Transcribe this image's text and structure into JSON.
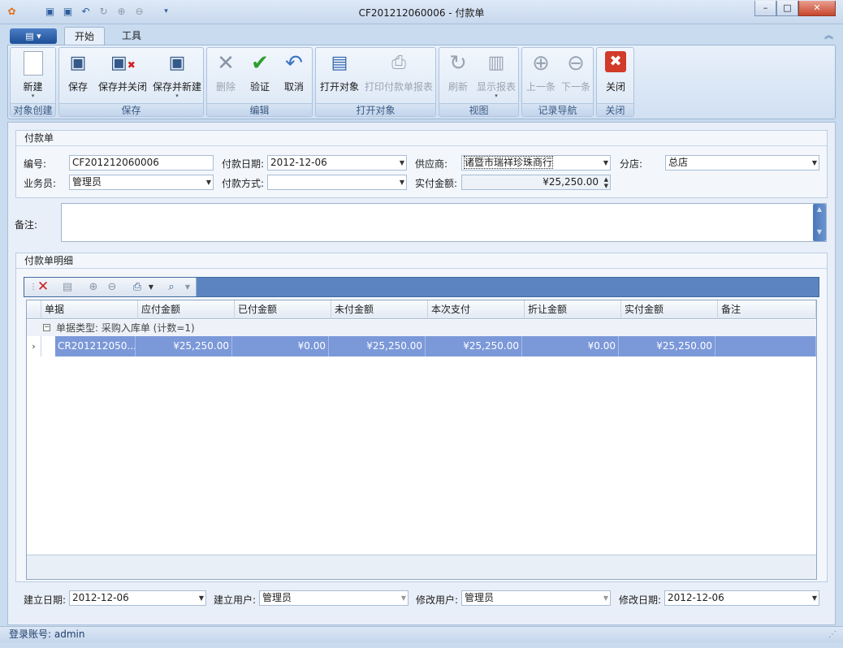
{
  "window": {
    "title": "CF201212060006 - 付款单",
    "minimize": "–",
    "maximize": "□",
    "close": "✕"
  },
  "ribbon": {
    "tabs": [
      "开始",
      "工具"
    ],
    "groups": {
      "create": {
        "caption": "对象创建",
        "new": "新建"
      },
      "save": {
        "caption": "保存",
        "save": "保存",
        "save_close": "保存并关闭",
        "save_new": "保存并新建"
      },
      "edit": {
        "caption": "编辑",
        "delete": "删除",
        "validate": "验证",
        "cancel": "取消"
      },
      "open": {
        "caption": "打开对象",
        "open_object": "打开对象",
        "print_report": "打印付款单报表"
      },
      "view": {
        "caption": "视图",
        "refresh": "刷新",
        "show_report": "显示报表"
      },
      "nav": {
        "caption": "记录导航",
        "prev": "上一条",
        "next": "下一条"
      },
      "close": {
        "caption": "关闭",
        "close": "关闭"
      }
    }
  },
  "form": {
    "section_title": "付款单",
    "number_label": "编号:",
    "number": "CF201212060006",
    "date_label": "付款日期:",
    "date": "2012-12-06",
    "supplier_label": "供应商:",
    "supplier": "诸暨市瑞祥珍珠商行",
    "branch_label": "分店:",
    "branch": "总店",
    "clerk_label": "业务员:",
    "clerk": "管理员",
    "method_label": "付款方式:",
    "method": "",
    "paid_label": "实付金额:",
    "paid": "¥25,250.00",
    "remark_label": "备注:",
    "remark": ""
  },
  "details": {
    "section_title": "付款单明细",
    "columns": [
      "单据",
      "应付金额",
      "已付金额",
      "未付金额",
      "本次支付",
      "折让金额",
      "实付金额",
      "备注"
    ],
    "group_label": "单据类型: 采购入库单 (计数=1)",
    "rows": [
      [
        "CR201212050...",
        "¥25,250.00",
        "¥0.00",
        "¥25,250.00",
        "¥25,250.00",
        "¥0.00",
        "¥25,250.00",
        ""
      ]
    ]
  },
  "audit": {
    "created_date_label": "建立日期:",
    "created_date": "2012-12-06",
    "created_user_label": "建立用户:",
    "created_user": "管理员",
    "modified_user_label": "修改用户:",
    "modified_user": "管理员",
    "modified_date_label": "修改日期:",
    "modified_date": "2012-12-06"
  },
  "status": {
    "account": "登录账号: admin"
  }
}
